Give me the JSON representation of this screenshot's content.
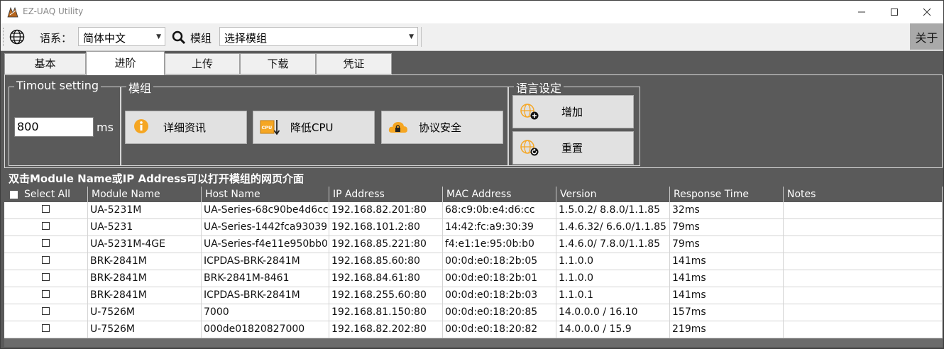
{
  "window": {
    "title": "EZ-UAQ Utility",
    "minimize": "—",
    "maximize": "☐",
    "close": "✕"
  },
  "toolbar": {
    "language_label": "语系：",
    "language_value": "简体中文",
    "module_label": "模组",
    "module_value": "选择模组",
    "about": "关于"
  },
  "tabs": [
    {
      "label": "基本",
      "active": false
    },
    {
      "label": "进阶",
      "active": true
    },
    {
      "label": "上传",
      "active": false
    },
    {
      "label": "下载",
      "active": false
    },
    {
      "label": "凭证",
      "active": false
    }
  ],
  "timeout": {
    "legend": "Timout setting",
    "value": "800",
    "unit": "ms"
  },
  "module_group": {
    "legend": "模组",
    "detail_button": "详细资讯",
    "cpu_button": "降低CPU",
    "security_button": "协议安全"
  },
  "language_group": {
    "legend": "语言设定",
    "add_button": "增加",
    "reset_button": "重置"
  },
  "info_text": "双击Module Name或IP Address可以打开模组的网页介面",
  "table": {
    "columns": [
      "Select All",
      "Module Name",
      "Host Name",
      "IP Address",
      "MAC Address",
      "Version",
      "Response Time",
      "Notes"
    ],
    "rows": [
      [
        "UA-5231M",
        "UA-Series-68c90be4d6cc",
        "192.168.82.201:80",
        "68:c9:0b:e4:d6:cc",
        "1.5.0.2/ 8.8.0/1.1.85",
        "32ms",
        ""
      ],
      [
        "UA-5231",
        "UA-Series-1442fca93039",
        "192.168.101.2:80",
        "14:42:fc:a9:30:39",
        "1.4.6.32/ 6.6.0/1.1.85",
        "79ms",
        ""
      ],
      [
        "UA-5231M-4GE",
        "UA-Series-f4e11e950bb0",
        "192.168.85.221:80",
        "f4:e1:1e:95:0b:b0",
        "1.4.6.0/ 7.8.0/1.1.85",
        "79ms",
        ""
      ],
      [
        "BRK-2841M",
        "ICPDAS-BRK-2841M",
        "192.168.85.60:80",
        "00:0d:e0:18:2b:05",
        "1.1.0.0",
        "141ms",
        ""
      ],
      [
        "BRK-2841M",
        "BRK-2841M-8461",
        "192.168.84.61:80",
        "00:0d:e0:18:2b:01",
        "1.1.0.0",
        "141ms",
        ""
      ],
      [
        "BRK-2841M",
        "ICPDAS-BRK-2841M",
        "192.168.255.60:80",
        "00:0d:e0:18:2b:03",
        "1.1.0.1",
        "141ms",
        ""
      ],
      [
        "U-7526M",
        "7000",
        "192.168.81.150:80",
        "00:0d:e0:18:20:85",
        "14.0.0.0 / 16.10",
        "157ms",
        ""
      ],
      [
        "U-7526M",
        "000de01820827000",
        "192.168.82.202:80",
        "00:0d:e0:18:20:82",
        "14.0.0.0 / 15.9",
        "219ms",
        ""
      ]
    ]
  }
}
